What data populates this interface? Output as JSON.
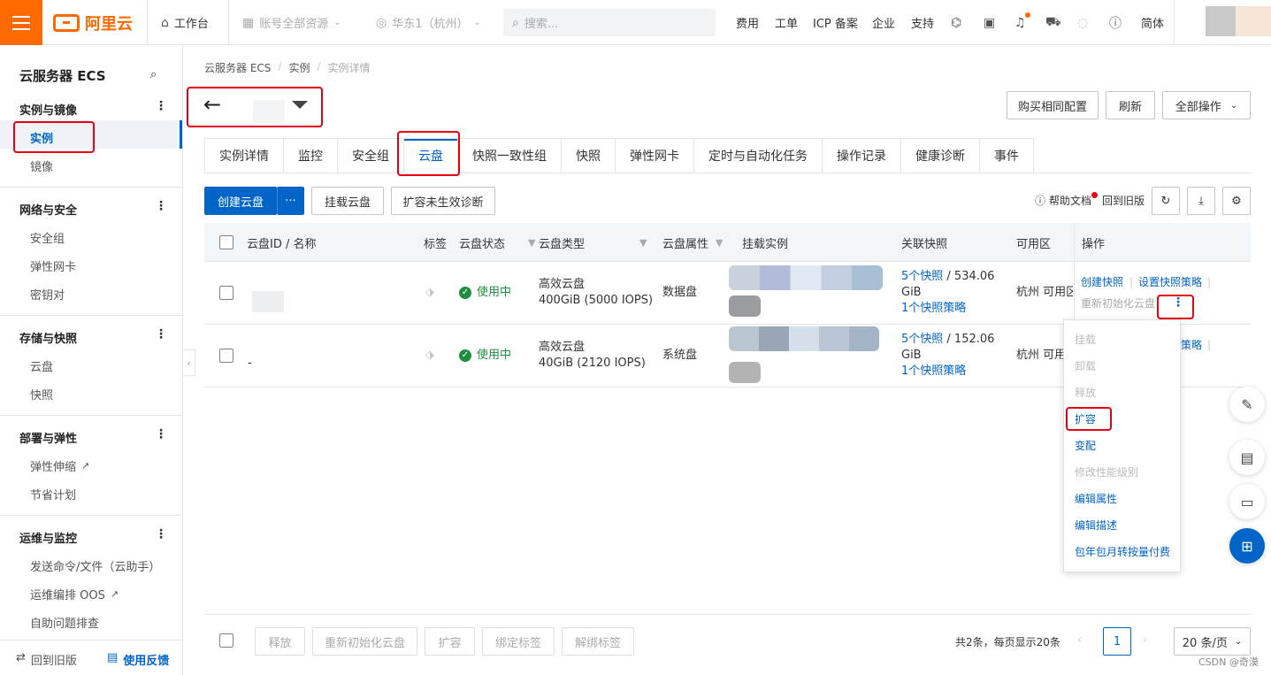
{
  "topbar": {
    "brand": "阿里云",
    "workbench": "工作台",
    "resources": "账号全部资源",
    "region": "华东1（杭州）",
    "search_placeholder": "搜索...",
    "links": [
      "费用",
      "工单",
      "ICP 备案",
      "企业",
      "支持"
    ],
    "lang": "简体"
  },
  "sidebar": {
    "title": "云服务器 ECS",
    "groups": [
      {
        "label": "实例与镜像",
        "items": [
          "实例",
          "镜像"
        ]
      },
      {
        "label": "网络与安全",
        "items": [
          "安全组",
          "弹性网卡",
          "密钥对"
        ]
      },
      {
        "label": "存储与快照",
        "items": [
          "云盘",
          "快照"
        ]
      },
      {
        "label": "部署与弹性",
        "items": [
          "弹性伸缩",
          "节省计划"
        ]
      },
      {
        "label": "运维与监控",
        "items": [
          "发送命令/文件（云助手）",
          "运维编排 OOS",
          "自助问题排查"
        ]
      }
    ],
    "back_old": "回到旧版",
    "feedback": "使用反馈"
  },
  "breadcrumb": [
    "云服务器 ECS",
    "实例",
    "实例详情"
  ],
  "header_buttons": {
    "buy_same": "购买相同配置",
    "refresh": "刷新",
    "all_ops": "全部操作"
  },
  "tabs": [
    "实例详情",
    "监控",
    "安全组",
    "云盘",
    "快照一致性组",
    "快照",
    "弹性网卡",
    "定时与自动化任务",
    "操作记录",
    "健康诊断",
    "事件"
  ],
  "toolbar": {
    "create_disk": "创建云盘",
    "more": "···",
    "attach_disk": "挂载云盘",
    "diagnose": "扩容未生效诊断",
    "help_doc": "帮助文档",
    "back_old": "回到旧版"
  },
  "table": {
    "headers": [
      "云盘ID / 名称",
      "标签",
      "云盘状态",
      "云盘类型",
      "云盘属性",
      "挂载实例",
      "关联快照",
      "可用区",
      "操作"
    ],
    "rows": [
      {
        "name": "",
        "status": "使用中",
        "type_line1": "高效云盘",
        "type_line2": "400GiB (5000 IOPS)",
        "attr": "数据盘",
        "snap_count": "5个快照",
        "snap_size": " / 534.06",
        "snap_unit": "GiB",
        "snap_policy": "1个快照策略",
        "zone": "杭州 可用区",
        "op1": "创建快照",
        "op2": "设置快照策略",
        "op3": "重新初始化云盘"
      },
      {
        "name": "-",
        "status": "使用中",
        "type_line1": "高效云盘",
        "type_line2": "40GiB (2120 IOPS)",
        "attr": "系统盘",
        "snap_count": "5个快照",
        "snap_size": " / 152.06",
        "snap_unit": "GiB",
        "snap_policy": "1个快照策略",
        "zone": "杭州 可用",
        "op2_partial": "策略"
      }
    ]
  },
  "dropdown": [
    "挂载",
    "卸载",
    "释放",
    "扩容",
    "变配",
    "修改性能级别",
    "编辑属性",
    "编辑描述",
    "包年包月转按量付费"
  ],
  "footer": {
    "batch": [
      "释放",
      "重新初始化云盘",
      "扩容",
      "绑定标签",
      "解绑标签"
    ],
    "summary": "共2条，每页显示20条",
    "page": "1",
    "page_size": "20 条/页"
  },
  "watermark": "CSDN @奇漠",
  "colors": {
    "brand": "#ff6a00",
    "primary": "#0064c8",
    "highlight": "#e60012",
    "success": "#1e8e3e"
  }
}
